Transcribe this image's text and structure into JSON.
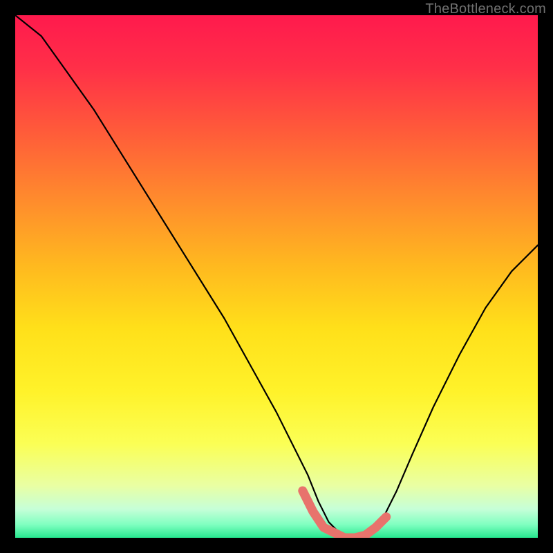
{
  "watermark": "TheBottleneck.com",
  "colors": {
    "black": "#000000",
    "curve": "#000000",
    "marker": "#e8736c",
    "gradient_stops": [
      {
        "offset": 0.0,
        "color": "#ff1a4d"
      },
      {
        "offset": 0.1,
        "color": "#ff2f48"
      },
      {
        "offset": 0.22,
        "color": "#ff5a3a"
      },
      {
        "offset": 0.35,
        "color": "#ff8a2d"
      },
      {
        "offset": 0.48,
        "color": "#ffb91f"
      },
      {
        "offset": 0.6,
        "color": "#ffe01a"
      },
      {
        "offset": 0.72,
        "color": "#fff22a"
      },
      {
        "offset": 0.82,
        "color": "#fbff55"
      },
      {
        "offset": 0.9,
        "color": "#e9ffa3"
      },
      {
        "offset": 0.945,
        "color": "#c6ffd8"
      },
      {
        "offset": 0.975,
        "color": "#7fffc0"
      },
      {
        "offset": 1.0,
        "color": "#27e88f"
      }
    ]
  },
  "chart_data": {
    "type": "line",
    "title": "",
    "xlabel": "",
    "ylabel": "",
    "xlim": [
      0,
      100
    ],
    "ylim": [
      0,
      100
    ],
    "grid": false,
    "background": "vertical-gradient-red-to-green",
    "description": "Bottleneck-style V curve; y is bottleneck percentage (0 at bottom), minimum plateau near x≈58–70",
    "series": [
      {
        "name": "bottleneck-curve",
        "x": [
          0,
          5,
          10,
          15,
          20,
          25,
          30,
          35,
          40,
          45,
          50,
          53,
          56,
          58,
          60,
          62,
          64,
          66,
          68,
          70,
          73,
          76,
          80,
          85,
          90,
          95,
          100
        ],
        "y": [
          100,
          96,
          89,
          82,
          74,
          66,
          58,
          50,
          42,
          33,
          24,
          18,
          12,
          7,
          3,
          1,
          0,
          0,
          1,
          3,
          9,
          16,
          25,
          35,
          44,
          51,
          56
        ]
      }
    ],
    "markers": {
      "name": "optimal-range-markers",
      "color": "#e8736c",
      "points": [
        {
          "x": 55,
          "y": 9
        },
        {
          "x": 57,
          "y": 5
        },
        {
          "x": 59,
          "y": 2
        },
        {
          "x": 61,
          "y": 1
        },
        {
          "x": 63,
          "y": 0
        },
        {
          "x": 65,
          "y": 0
        },
        {
          "x": 67,
          "y": 0.5
        },
        {
          "x": 69,
          "y": 2
        },
        {
          "x": 71,
          "y": 4
        }
      ]
    }
  }
}
